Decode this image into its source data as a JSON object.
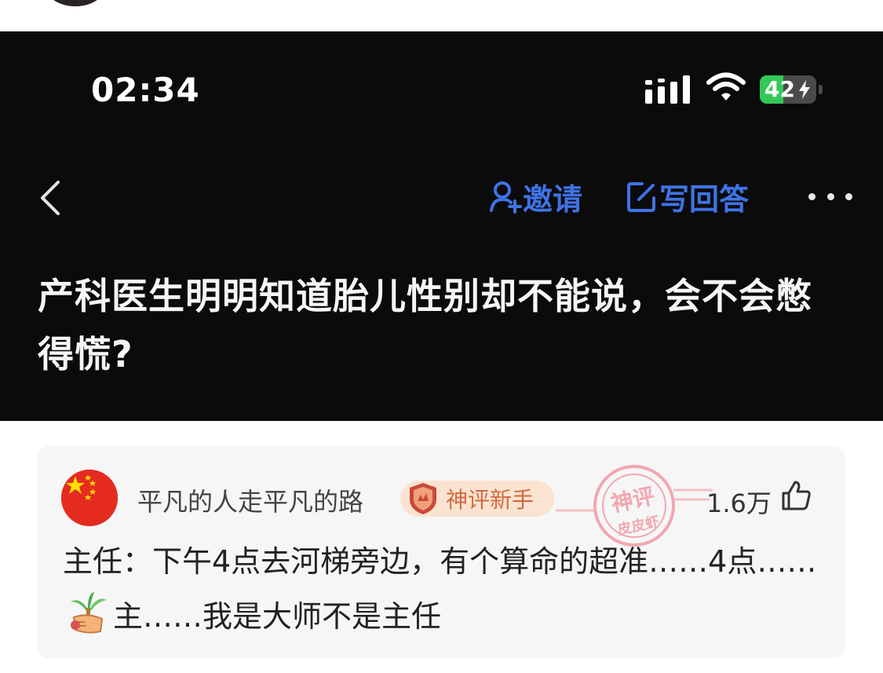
{
  "status_bar": {
    "time": "02:34",
    "battery": "42",
    "battery_level_percent": 42,
    "icons": [
      "cellular-signal-icon",
      "wifi-icon",
      "battery-charging-icon"
    ]
  },
  "nav": {
    "back_icon": "chevron-left-icon",
    "invite_label": "邀请",
    "invite_icon": "add-user-icon",
    "write_answer_label": "写回答",
    "write_answer_icon": "edit-icon",
    "more_icon": "more-dots-icon"
  },
  "question": {
    "title": "产科医生明明知道胎儿性别却不能说，会不会憋得慌?"
  },
  "comment": {
    "username": "平凡的人走平凡的路",
    "badge": "神评新手",
    "stamp_text_top": "神评",
    "stamp_text_bottom": "皮皮虾",
    "like_count": "1.6万",
    "text_part1": "主任：下午4点去河梯旁边，有个算命的超准……4点……",
    "text_part2": "主……我是大师不是主任",
    "emoji_icon": "coconut-tree-hand-emoji"
  },
  "colors": {
    "accent_blue": "#3f73e5",
    "dark_background": "#0b0b0c",
    "battery_green": "#34c759",
    "badge_bg": "#fbe3d2",
    "badge_text": "#d06a3e",
    "flag_red": "#e52b1f",
    "stamp_red": "#e23a4a"
  }
}
